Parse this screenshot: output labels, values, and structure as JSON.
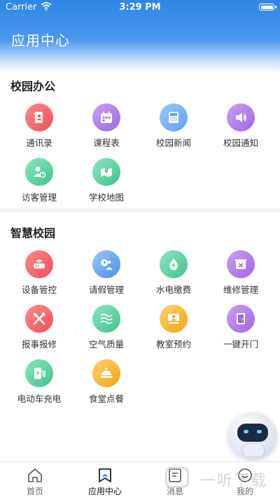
{
  "status_bar": {
    "carrier": "Carrier",
    "time": "3:29 PM"
  },
  "header": {
    "title": "应用中心"
  },
  "sections": [
    {
      "title": "校园办公",
      "items": [
        {
          "label": "通讯录",
          "icon": "contacts-icon",
          "color": "#f2656a"
        },
        {
          "label": "课程表",
          "icon": "calendar-icon",
          "color": "#b07de8"
        },
        {
          "label": "校园新闻",
          "icon": "news-icon",
          "color": "#6ea9f2"
        },
        {
          "label": "校园通知",
          "icon": "speaker-icon",
          "color": "#b07de8"
        },
        {
          "label": "访客管理",
          "icon": "visitor-icon",
          "color": "#55cf9e"
        },
        {
          "label": "学校地图",
          "icon": "map-pin-icon",
          "color": "#55cf9e"
        }
      ]
    },
    {
      "title": "智慧校园",
      "items": [
        {
          "label": "设备管控",
          "icon": "router-icon",
          "color": "#f2656a"
        },
        {
          "label": "请假管理",
          "icon": "leave-icon",
          "color": "#5fa3f0"
        },
        {
          "label": "水电缴费",
          "icon": "water-bolt-icon",
          "color": "#55cf9e"
        },
        {
          "label": "维修管理",
          "icon": "repair-box-icon",
          "color": "#b07de8"
        },
        {
          "label": "报事报修",
          "icon": "tools-icon",
          "color": "#f2656a"
        },
        {
          "label": "空气质量",
          "icon": "air-waves-icon",
          "color": "#55cf9e"
        },
        {
          "label": "教室预约",
          "icon": "classroom-icon",
          "color": "#f6b52a"
        },
        {
          "label": "一键开门",
          "icon": "door-icon",
          "color": "#b07de8"
        },
        {
          "label": "电动车充电",
          "icon": "charging-icon",
          "color": "#55cf9e"
        },
        {
          "label": "食堂点餐",
          "icon": "dining-bell-icon",
          "color": "#f6b52a"
        }
      ]
    }
  ],
  "floating_assistant": {
    "icon": "robot-icon"
  },
  "tab_bar": {
    "tabs": [
      {
        "label": "首页",
        "icon": "home-icon",
        "active": false
      },
      {
        "label": "应用中心",
        "icon": "app-center-icon",
        "active": true
      },
      {
        "label": "消息",
        "icon": "message-icon",
        "active": false
      },
      {
        "label": "我的",
        "icon": "profile-icon",
        "active": false
      }
    ]
  },
  "watermark": {
    "text": "一听下载"
  }
}
